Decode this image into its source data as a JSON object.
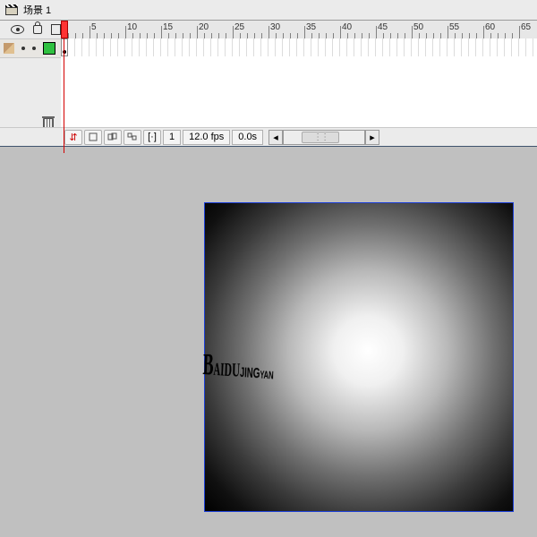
{
  "title": "场景 1",
  "ruler": {
    "start": 1,
    "end": 65,
    "step": 5,
    "pxPerFrame": 8
  },
  "status": {
    "frame": "1",
    "fps": "12.0 fps",
    "time": "0.0s"
  },
  "canvas": {
    "logo_b": "B",
    "logo_aidu": "AIDU",
    "logo_jing": "JING",
    "logo_yan": "YAN"
  },
  "icons": {
    "html": "html"
  }
}
